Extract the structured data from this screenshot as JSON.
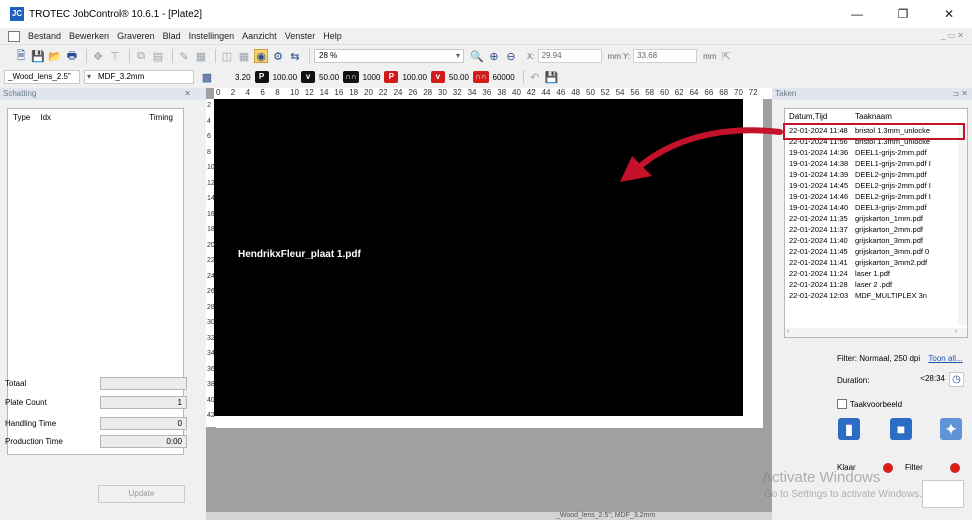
{
  "window": {
    "title": "TROTEC JobControl® 10.6.1 - [Plate2]",
    "app_icon": "JC"
  },
  "menu": {
    "items": [
      "Bestand",
      "Bewerken",
      "Graveren",
      "Blad",
      "Instellingen",
      "Aanzicht",
      "Venster",
      "Help"
    ]
  },
  "toolbar": {
    "zoom": "28 %",
    "x_label": "X:",
    "x_value": "29.94",
    "y_label": "mm  Y:",
    "y_value": "33.68",
    "unit": "mm"
  },
  "params": {
    "material_template": "_Wood_lens_2.5\"",
    "material": "MDF_3.2mm",
    "thickness": "3.20",
    "p1": "100.00",
    "v1": "50.00",
    "ppi": "1000",
    "p2": "100.00",
    "v2": "50.00",
    "hz": "60000"
  },
  "left_panel": {
    "title": "Schatting",
    "col_type": "Type",
    "col_idx": "Idx",
    "col_timing": "Timing",
    "totaal_label": "Totaal",
    "totaal_value": "",
    "plate_count_label": "Plate Count",
    "plate_count_value": "1",
    "handling_label": "Handling Time",
    "handling_value": "0",
    "production_label": "Production Time",
    "production_value": "0:00",
    "update_label": "Update"
  },
  "canvas": {
    "h_ruler": [
      "0",
      "2",
      "4",
      "6",
      "8",
      "10",
      "12",
      "14",
      "16",
      "18",
      "20",
      "22",
      "24",
      "26",
      "28",
      "30",
      "32",
      "34",
      "36",
      "38",
      "40",
      "42",
      "44",
      "46",
      "48",
      "50",
      "52",
      "54",
      "56",
      "58",
      "60",
      "62",
      "64",
      "66",
      "68",
      "70",
      "72"
    ],
    "v_ruler": [
      "2",
      "4",
      "6",
      "8",
      "10",
      "12",
      "14",
      "16",
      "18",
      "20",
      "22",
      "24",
      "26",
      "28",
      "30",
      "32",
      "34",
      "36",
      "38",
      "40",
      "42"
    ],
    "job_name": "HendrikxFleur_plaat 1.pdf",
    "status_bar": "_Wood_lens_2.5\"; MDF_3.2mm"
  },
  "right_panel": {
    "title": "Taken",
    "col_date": "Datum,Tijd",
    "col_name": "Taaknaam",
    "jobs": [
      {
        "date": "22-01-2024 11:48",
        "name": "bristol 1.3mm_unlocke"
      },
      {
        "date": "22-01-2024 11:56",
        "name": "bristol 1.3mm_unlocke"
      },
      {
        "date": "19-01-2024 14:36",
        "name": "DEEL1-grijs-2mm.pdf"
      },
      {
        "date": "19-01-2024 14:38",
        "name": "DEEL1-grijs-2mm.pdf I"
      },
      {
        "date": "19-01-2024 14:39",
        "name": "DEEL2-grijs-2mm.pdf"
      },
      {
        "date": "19-01-2024 14:45",
        "name": "DEEL2-grijs-2mm.pdf I"
      },
      {
        "date": "19-01-2024 14:46",
        "name": "DEEL2-grijs-2mm.pdf I"
      },
      {
        "date": "19-01-2024 14:40",
        "name": "DEEL3-grijs-2mm.pdf"
      },
      {
        "date": "22-01-2024 11:35",
        "name": "grijskarton_1mm.pdf"
      },
      {
        "date": "22-01-2024 11:37",
        "name": "grijskarton_2mm.pdf"
      },
      {
        "date": "22-01-2024 11:40",
        "name": "grijskarton_3mm.pdf"
      },
      {
        "date": "22-01-2024 11:45",
        "name": "grijskarton_3mm.pdf 0"
      },
      {
        "date": "22-01-2024 11:41",
        "name": "grijskarton_3mm2.pdf"
      },
      {
        "date": "22-01-2024 11:24",
        "name": "laser 1.pdf"
      },
      {
        "date": "22-01-2024 11:28",
        "name": "laser 2 .pdf"
      },
      {
        "date": "22-01-2024 12:03",
        "name": "MDF_MULTIPLEX 3n"
      }
    ],
    "filter_text": "Filter: Normaal, 250 dpi",
    "toon_all": "Toon all...",
    "duration_label": "Duration:",
    "duration_value": "<28:34",
    "taskpreview_label": "Taakvoorbeeld",
    "klaar_label": "Klaar",
    "filter_label": "Filter"
  },
  "watermark": {
    "line1": "Activate Windows",
    "line2": "Go to Settings to activate Windows."
  },
  "colors": {
    "accent_blue": "#1f5fbf",
    "annotation_red": "#c4122a",
    "plate_black": "#000000"
  }
}
